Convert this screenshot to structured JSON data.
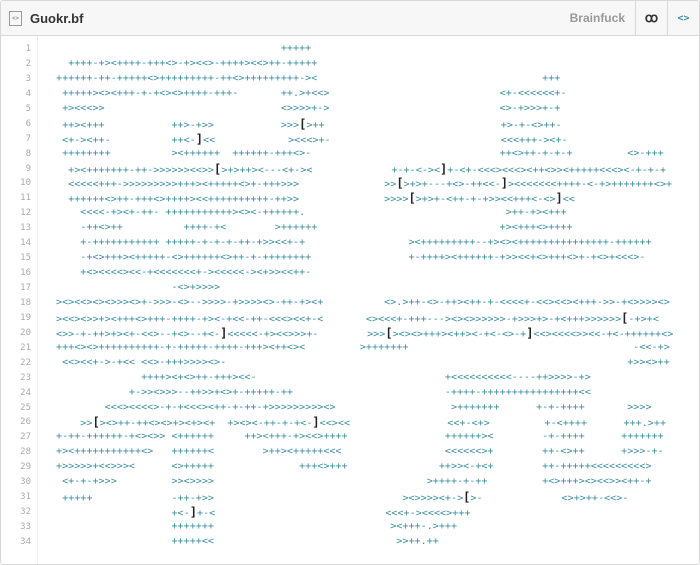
{
  "header": {
    "file_icon": "code-file-icon",
    "filename": "Guokr.bf",
    "language": "Brainfuck",
    "link_icon": "link-icon",
    "code_icon": "code-brackets-icon",
    "link_glyph": "ꝏ",
    "code_glyph": "<>",
    "file_glyph": "<>"
  },
  "code_lines": [
    "                                     +++++",
    "  ++++-+><++++-+++<>-+><<>-++++><<>++-+++++",
    "++++++-++-+++++<>+++++++++-++<>+++++++++-><                                     +++",
    " +++++><><+++-+-+<><>++++-+++-       ++.>+<<>                            <+-<<<<<<+-",
    " +><<<>>                             <>>>>+->                            <>-+>>>+-+",
    " ++><+++           ++>-+>>           >>>[>++                             +>-+-<>++-",
    " <+-><++-          ++<-]<<            ><<<>+-                            <<<+++-><+-",
    " ++++++++          ><++++++  ++++++-+++<>-                               ++<>++-+-+-+         <>-+++",
    "  +><+++++++-++->>>>>><<>>[>+>++><---<+-><             +-+-<-><]+-<+-<<<><<<><++<>><+++++<<<><-+-+-+",
    "  <<<<<+++->>>>>>>>>+++><+++++<>+-+++>>>              >>[>+>+---+<>-++<<-]><<<<<<<++++-<-+>+++++++<>+",
    "  ++++++<>++-+++<>++++><<++++++++++-++>>              >>>>[>+>+-<++-+-+>><<+++<-<>]<<",
    "    <<<<-+><+-++- +++++++++++><><-++++++.                                 >++-+><+++",
    "    -++<>++          ++++-+<        >++++++                              +><+++<>++++",
    "    +-+++++++++++ +++++-+-+-+-++-+>><<+-+                 ><+++++++++--+><><+++++++++++++++-++++++",
    "    -+<>+++><+++++-<>++++++<>++-+-++++++++                +-++++><++++++-+>><<+<>+++<>+-+<>+<<<>-",
    "    +<><<<<><<-+<<<<<<<+-><<<<<-><+>><<++-",
    "                   -<>+>>>>",
    "><><<><><>>><>+->>>-<>-->>>>-+>>>><>-++-+><+          <>.>++-<>-++><++-+-<<<<+-<<><<><+++->>-+<>>>><>",
    "><<><>>+><+++<>+++-++++-+><-+<<-++-<<<><<+-<       <><<<+-+++---><><>>>>>>-+>>>+>-+<+++>>>>>>[-+>+<",
    "<>>-+-++>+><+-<<>--+<>--+<-]<<<<<-+><<>>>+-        >>>[><><>+++><++><-+<-<>-+]<<><<<<>><<-+<-++++++<>",
    "+++<><>++++++++++-+-+++++-++++-+++><++<><         >+++++++                                     -<<-+>",
    " <<><<+->-+<< <<>-+++>>>><>-                                                                  +>><>++",
    "              ++++><+<>++-+++><<-                               +<<<<<<<<<<----++>>>>-+>",
    "            +->><>>>--++>>+<>+-+++++-++                         -++++-++++++++++++++++<<",
    "        <<<><<<<>-+-+<<<><++-+-++-+>>>>>>>>><>                   >+++++++      +-+-++++       >>>>",
    "    >>[><>++-++<><>+><+><+  +><><-++-+-+<-]<<><<                <<+-<+>         +-<++++      +++.>++",
    "+-++-++++++-+<><>> <++++++     ++><+++-+><<>++++                ++++++><        -+-++++      +++++++",
    "+><+++++++++++<>   ++++++<        >++><+++++<<<                 <<<<<<>+        ++-<>++      +>>>-+-",
    "+>>>>>+<<>>><      <>+++++              +++<>+++               ++>><-+<+        ++-+++++<<<<<<<<<>",
    " <+-+-+>>>         >><>>>>                                   >++++-+-++         +<>+++><><<>><++-+",
    " +++++             -++-+>>                               ><>>>><+->[>-             <>+>++-<<>-",
    "                   +<-]+-<                            <<<+-><<<<>+++",
    "                   +++++++                             ><+++-.>+++",
    "                   +++++<<                              >>++.++"
  ],
  "colors": {
    "code": "#3d8fa0",
    "bracket": "#222222",
    "line_number": "#aaaaaa",
    "header_bg": "#f7f7f7"
  }
}
